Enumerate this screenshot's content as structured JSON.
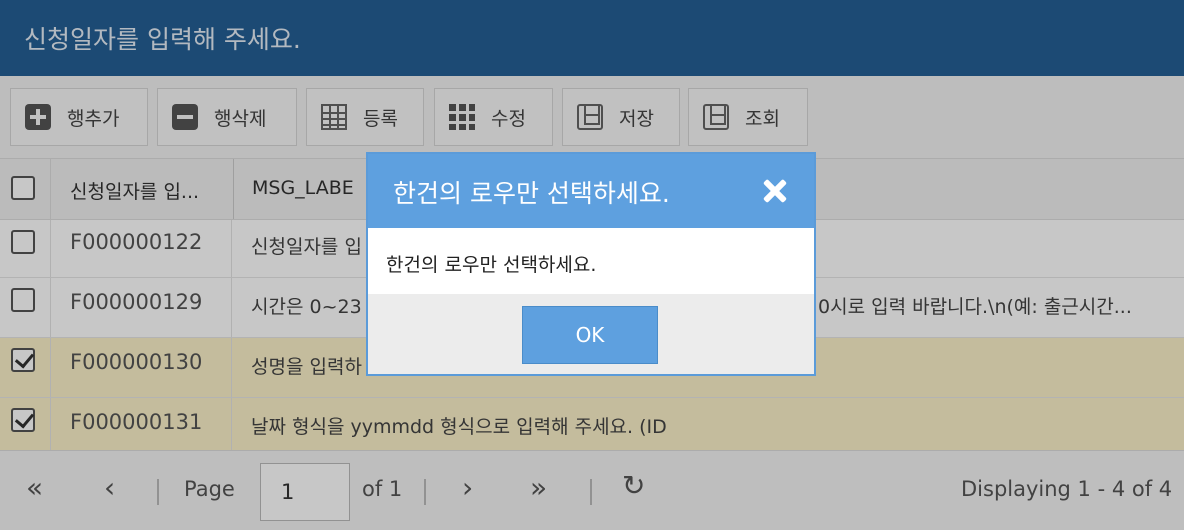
{
  "titlebar": {
    "title": "신청일자를 입력해 주세요."
  },
  "toolbar": {
    "buttons": [
      {
        "label": "행추가",
        "icon": "plus-square-icon"
      },
      {
        "label": "행삭제",
        "icon": "minus-square-icon"
      },
      {
        "label": "등록",
        "icon": "table-icon"
      },
      {
        "label": "수정",
        "icon": "grid-icon"
      },
      {
        "label": "저장",
        "icon": "save-icon"
      },
      {
        "label": "조회",
        "icon": "save-icon"
      }
    ]
  },
  "grid": {
    "columns": [
      "신청일자를 입...",
      "MSG_LABE"
    ],
    "rows": [
      {
        "id": "F000000122",
        "msg": "신청일자를 입",
        "checked": false
      },
      {
        "id": "F000000129",
        "msg": "시간은 0~23",
        "msg_tail": "0시로 입력 바랍니다.\\n(예: 출근시간...",
        "checked": false
      },
      {
        "id": "F000000130",
        "msg": "성명을 입력하",
        "checked": true
      },
      {
        "id": "F000000131",
        "msg": "날짜 형식을 yymmdd 형식으로 입력해 주세요. (ID",
        "checked": true
      }
    ]
  },
  "pager": {
    "page_label": "Page",
    "page_value": "1",
    "of_label": "of 1",
    "display_text": "Displaying 1 - 4 of 4"
  },
  "dialog": {
    "title": "한건의 로우만 선택하세요.",
    "message": "한건의 로우만 선택하세요.",
    "ok_label": "OK"
  },
  "colors": {
    "titlebar": "#245f95",
    "dialog_header": "#5ea0df",
    "selected_row": "#fbf1c9"
  }
}
